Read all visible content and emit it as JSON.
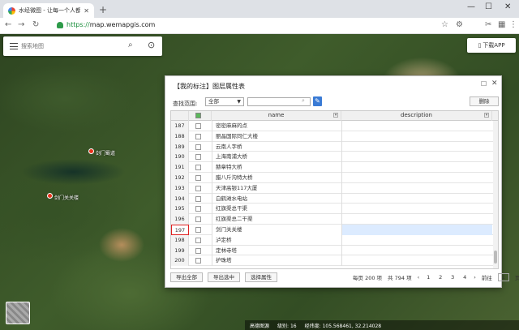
{
  "browser": {
    "tab_title": "水经微图 - 让每一个人都有自...",
    "url_scheme": "https://",
    "url_host": "map.wemapgis.com"
  },
  "map": {
    "search_placeholder": "搜索地图",
    "download_app": "下载APP",
    "markers": [
      {
        "label": "剑门蜀道"
      },
      {
        "label": "剑门关关楼"
      }
    ],
    "status": {
      "source": "高德图源",
      "level_label": "级别:",
      "level": "16",
      "coord_label": "经纬度:",
      "coords": "105.568461, 32.214028"
    }
  },
  "dialog": {
    "title": "【我的标注】图层属性表",
    "range_label": "查找范围:",
    "range_value": "全部",
    "delete_label": "删除",
    "columns": {
      "name": "name",
      "description": "description"
    },
    "rows": [
      {
        "n": "187",
        "name": "密密麻麻的点"
      },
      {
        "n": "188",
        "name": "丽晶国际同仁大楼"
      },
      {
        "n": "189",
        "name": "云南人字桥"
      },
      {
        "n": "190",
        "name": "上海南浦大桥"
      },
      {
        "n": "191",
        "name": "赫章特大桥"
      },
      {
        "n": "192",
        "name": "腊八斤沟特大桥"
      },
      {
        "n": "193",
        "name": "天津高银117大厦"
      },
      {
        "n": "194",
        "name": "白鹤滩水电站"
      },
      {
        "n": "195",
        "name": "红旗渠总干渠"
      },
      {
        "n": "196",
        "name": "红旗渠总二干渠"
      },
      {
        "n": "197",
        "name": "剑门关关楼"
      },
      {
        "n": "198",
        "name": "泸定桥"
      },
      {
        "n": "199",
        "name": "定林寺塔"
      },
      {
        "n": "200",
        "name": "护珠塔"
      }
    ],
    "footer": {
      "export_all": "导出全部",
      "export_selected": "导出选中",
      "choose_attr": "选择属性",
      "per_page": "每页 200 项",
      "total": "共 794 项",
      "pages": [
        "1",
        "2",
        "3",
        "4"
      ],
      "goto": "前往",
      "goto_value": "1",
      "page_unit": "页"
    }
  }
}
